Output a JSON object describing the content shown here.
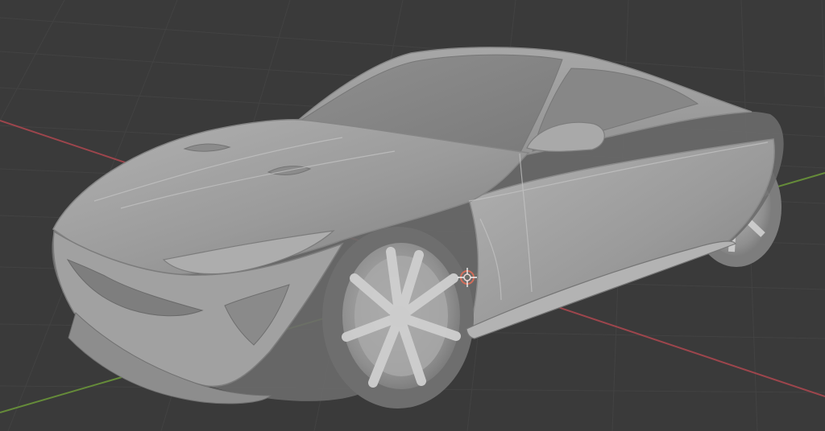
{
  "viewport": {
    "background_color": "#3a3a3a",
    "grid_color": "#454545",
    "x_axis_color": "#a8474f",
    "y_axis_color": "#6d9a3a",
    "model_color": "#9c9c9c",
    "model_shadow_color": "#6c6c6c",
    "model_highlight_color": "#c2c2c2"
  },
  "object": {
    "name": "sports car",
    "shading": "solid",
    "selected_origin_icon": "3d-cursor-icon"
  }
}
